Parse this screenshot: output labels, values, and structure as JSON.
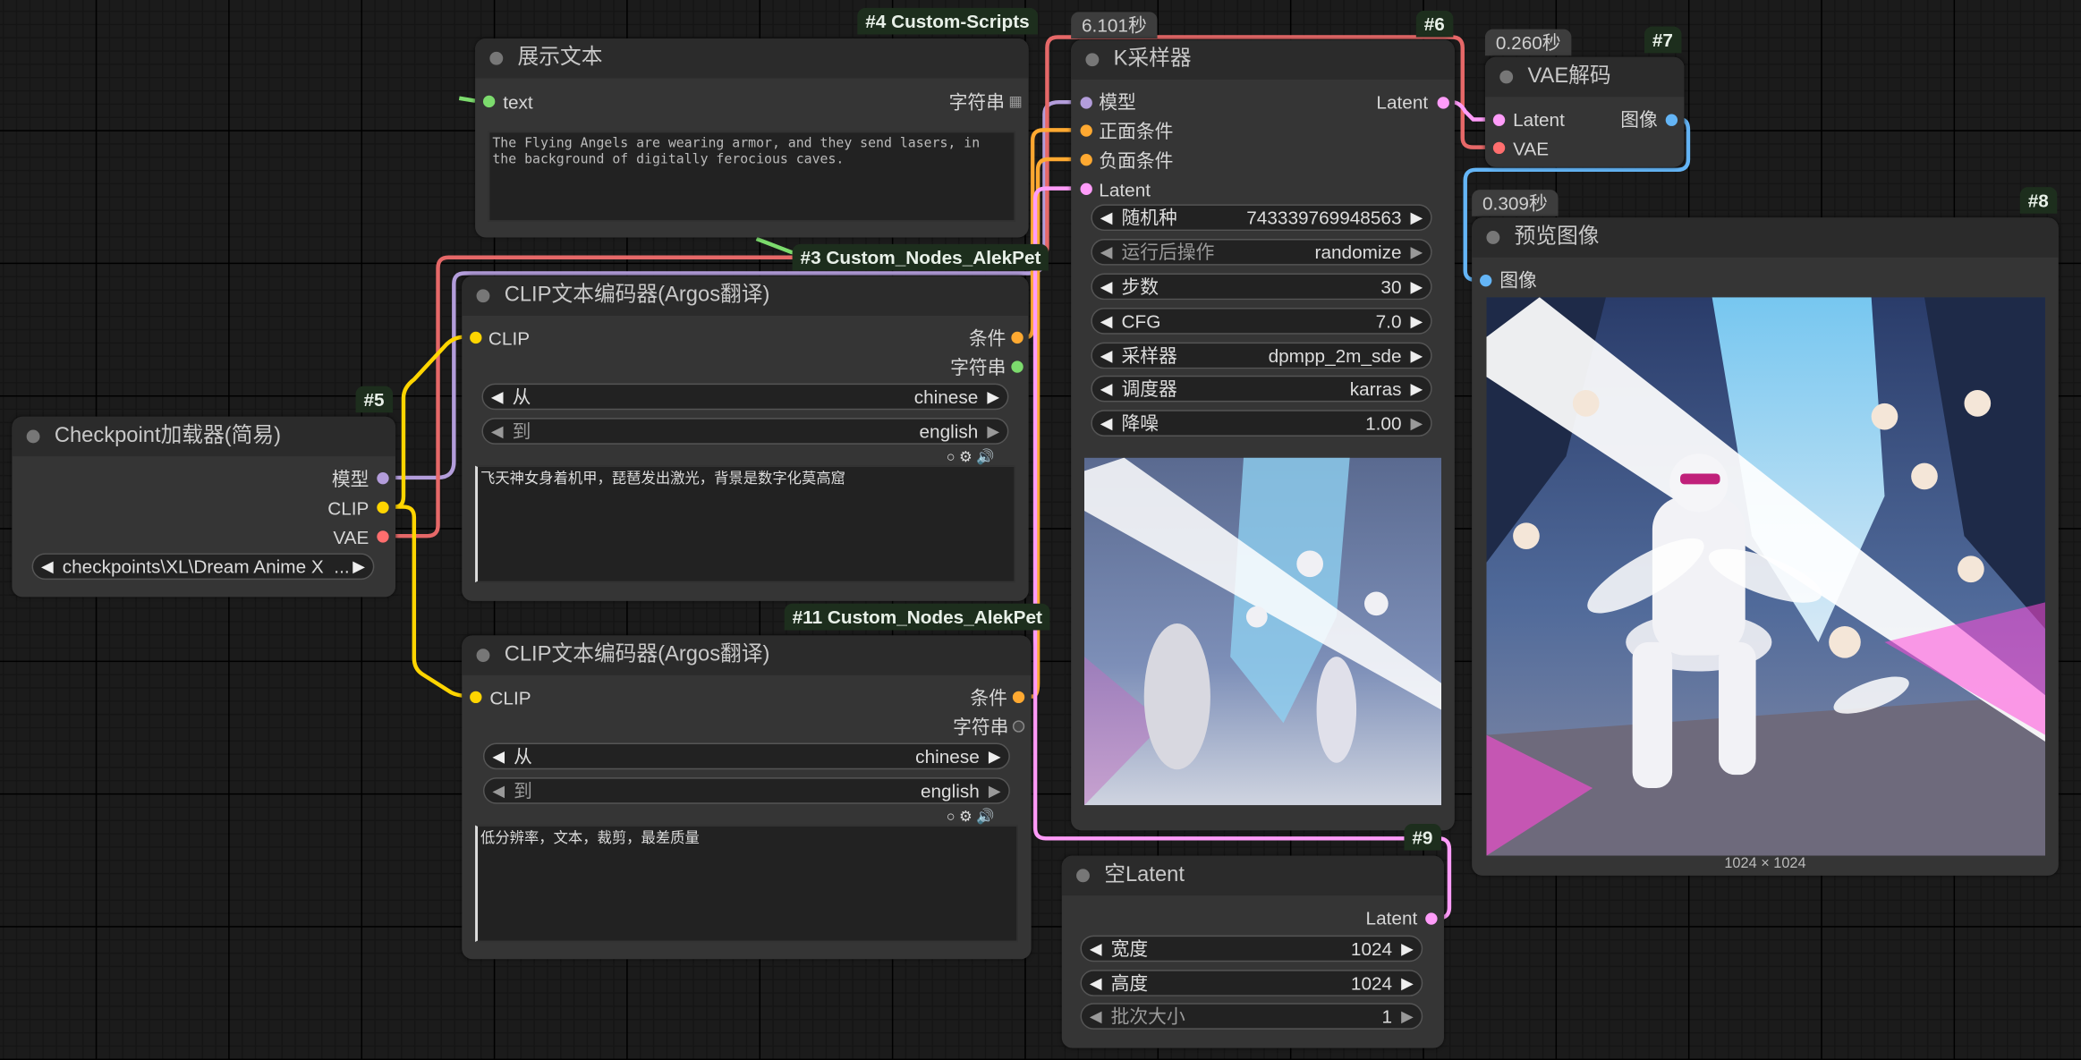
{
  "nodes": {
    "display_text": {
      "badge": "#4 Custom-Scripts",
      "title": "展示文本",
      "input_text": "text",
      "output_string": "字符串",
      "text_content": "The Flying Angels are wearing armor, and they send lasers, in the background of digitally ferocious caves."
    },
    "clip_encoder_1": {
      "badge": "#3 Custom_Nodes_AlekPet",
      "title": "CLIP文本编码器(Argos翻译)",
      "input_clip": "CLIP",
      "output_condition": "条件",
      "output_string": "字符串",
      "from_label": "从",
      "from_value": "chinese",
      "to_label": "到",
      "to_value": "english",
      "prompt_text": "飞天神女身着机甲，琵琶发出激光，背景是数字化莫高窟"
    },
    "clip_encoder_2": {
      "badge": "#11 Custom_Nodes_AlekPet",
      "title": "CLIP文本编码器(Argos翻译)",
      "input_clip": "CLIP",
      "output_condition": "条件",
      "output_string": "字符串",
      "from_label": "从",
      "from_value": "chinese",
      "to_label": "到",
      "to_value": "english",
      "prompt_text": "低分辨率，文本，裁剪，最差质量"
    },
    "checkpoint_loader": {
      "badge": "#5",
      "title": "Checkpoint加载器(简易)",
      "output_model": "模型",
      "output_clip": "CLIP",
      "output_vae": "VAE",
      "ckpt_value": "checkpoints\\XL\\Dream Anime X  ..."
    },
    "ksampler": {
      "badge": "#6",
      "time": "6.101秒",
      "title": "K采样器",
      "input_model": "模型",
      "input_positive": "正面条件",
      "input_negative": "负面条件",
      "input_latent": "Latent",
      "output_latent": "Latent",
      "widgets": [
        {
          "label": "随机种",
          "value": "743339769948563"
        },
        {
          "label": "运行后操作",
          "value": "randomize"
        },
        {
          "label": "步数",
          "value": "30"
        },
        {
          "label": "CFG",
          "value": "7.0"
        },
        {
          "label": "采样器",
          "value": "dpmpp_2m_sde"
        },
        {
          "label": "调度器",
          "value": "karras"
        },
        {
          "label": "降噪",
          "value": "1.00"
        }
      ]
    },
    "vae_decode": {
      "badge": "#7",
      "time": "0.260秒",
      "title": "VAE解码",
      "input_latent": "Latent",
      "input_vae": "VAE",
      "output_image": "图像"
    },
    "preview_image": {
      "badge": "#8",
      "time": "0.309秒",
      "title": "预览图像",
      "input_image": "图像",
      "image_size": "1024 × 1024"
    },
    "empty_latent": {
      "badge": "#9",
      "title": "空Latent",
      "output_latent": "Latent",
      "widgets": [
        {
          "label": "宽度",
          "value": "1024"
        },
        {
          "label": "高度",
          "value": "1024"
        },
        {
          "label": "批次大小",
          "value": "1"
        }
      ]
    }
  },
  "colors": {
    "model": "#b39ddb",
    "clip": "#ffd500",
    "vae": "#ff6e6e",
    "conditioning": "#ffa931",
    "latent": "#ff9cf9",
    "image": "#64b5f6",
    "string": "#7cdb6d",
    "canvas": "#1b1b1b",
    "node": "#353535"
  },
  "icons": [
    "grid-icon",
    "circle-icon",
    "gear-icon",
    "speaker-icon",
    "arrow-left-icon",
    "arrow-right-icon"
  ]
}
